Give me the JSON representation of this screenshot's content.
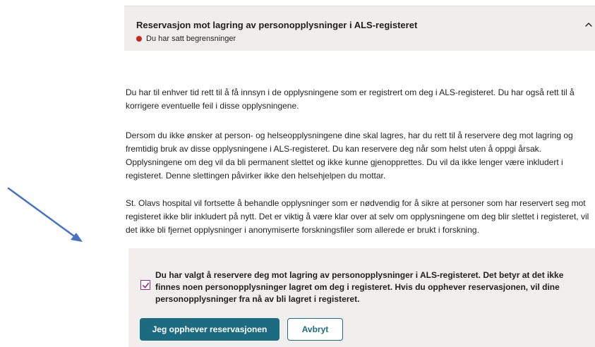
{
  "accordion": {
    "title": "Reservasjon mot lagring av personopplysninger i ALS-registeret",
    "status_text": "Du har satt begrensninger",
    "status_color": "#c8261e",
    "toggle_icon": "chevron-up-icon"
  },
  "body": {
    "paragraphs": [
      "Du har til enhver tid rett til å få innsyn i de opplysningene som er registrert om deg i ALS-registeret. Du har også rett til å korrigere eventuelle feil i disse opplysningene.",
      "Dersom du ikke ønsker at person- og helseopplysningene dine skal lagres, har du rett til å reservere deg mot lagring og fremtidig bruk av disse opplysningene i ALS-registeret. Du kan reservere deg når som helst uten å oppgi årsak. Opplysningene om deg vil da bli permanent slettet og ikke kunne gjenopprettes. Du vil da ikke lenger være inkludert i registeret. Denne slettingen påvirker ikke den helsehjelpen du mottar.",
      "St. Olavs hospital vil fortsette å behandle opplysninger som er nødvendig for å sikre at personer som har reservert seg mot registeret ikke blir inkludert på nytt. Det er viktig å være klar over at selv om opplysningene om deg blir slettet i registeret, vil det ikke bli fjernet opplysninger i anonymiserte forskningsfiler som allerede er brukt i forskning."
    ]
  },
  "confirm": {
    "checkbox_checked": true,
    "checkbox_color": "#9a2a7a",
    "text": "Du har valgt å reservere deg mot lagring av personopplysninger i ALS-registeret. Det betyr at det ikke finnes noen personopplysninger lagret om deg i registeret. Hvis du opphever reservasjonen, vil dine personopplysninger fra nå av bli lagret i registeret.",
    "primary_button_label": "Jeg opphever reservasjonen",
    "secondary_button_label": "Avbryt",
    "accent_color": "#1c6b80"
  },
  "annotation": {
    "arrow_color": "#4472c4"
  }
}
